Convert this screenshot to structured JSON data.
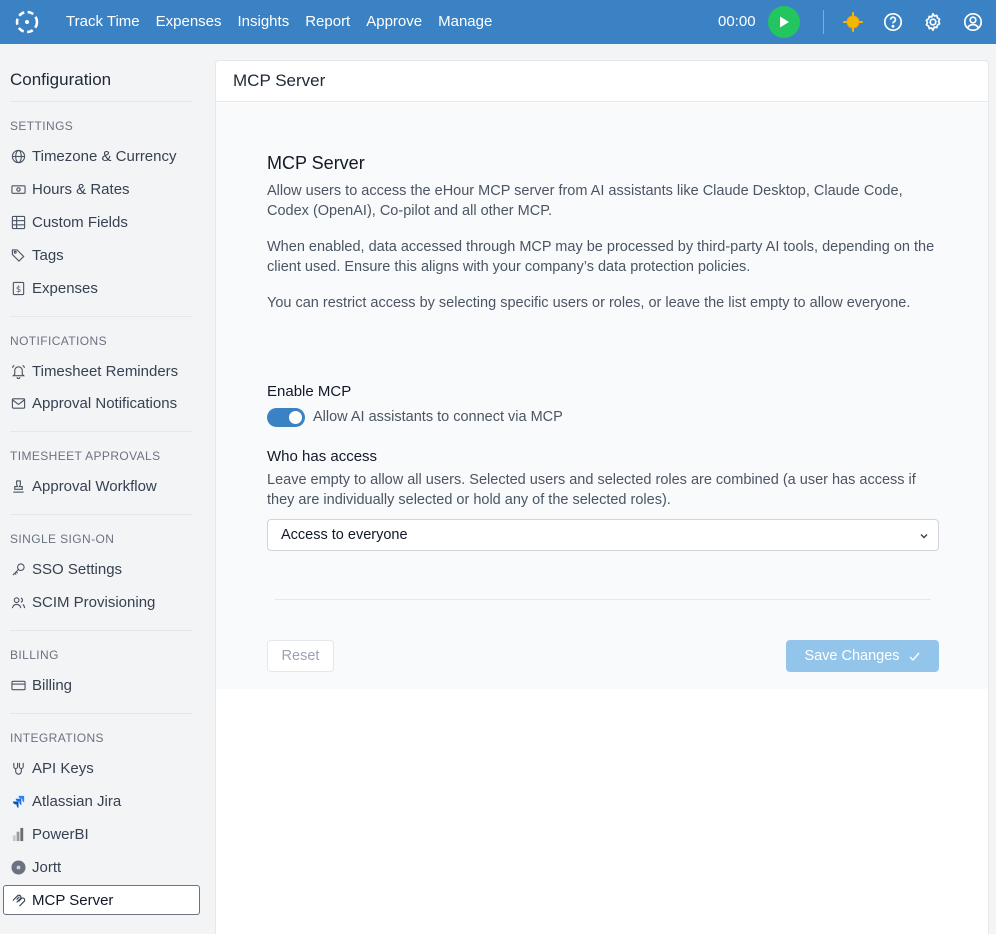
{
  "topbar": {
    "nav": [
      "Track Time",
      "Expenses",
      "Insights",
      "Report",
      "Approve",
      "Manage"
    ],
    "timer": "00:00",
    "accent": "#3b82c4",
    "play_color": "#22c55e"
  },
  "sidebar": {
    "title": "Configuration",
    "sections": {
      "settings": "SETTINGS",
      "notifications": "NOTIFICATIONS",
      "approvals": "TIMESHEET APPROVALS",
      "sso": "SINGLE SIGN-ON",
      "billing": "BILLING",
      "integrations": "INTEGRATIONS"
    },
    "items": {
      "timezone": "Timezone & Currency",
      "hours": "Hours & Rates",
      "custom_fields": "Custom Fields",
      "tags": "Tags",
      "expenses": "Expenses",
      "reminders": "Timesheet Reminders",
      "approval_notifications": "Approval Notifications",
      "approval_workflow": "Approval Workflow",
      "sso_settings": "SSO Settings",
      "scim": "SCIM Provisioning",
      "billing": "Billing",
      "api_keys": "API Keys",
      "jira": "Atlassian Jira",
      "powerbi": "PowerBI",
      "jortt": "Jortt",
      "mcp": "MCP Server"
    }
  },
  "panel": {
    "title": "MCP Server",
    "heading": "MCP Server",
    "desc1": "Allow users to access the eHour MCP server from AI assistants like Claude Desktop, Claude Code, Codex (OpenAI), Co-pilot and all other MCP.",
    "desc2": "When enabled, data accessed through MCP may be processed by third-party AI tools, depending on the client used. Ensure this aligns with your company’s data protection policies.",
    "desc3": "You can restrict access by selecting specific users or roles, or leave the list empty to allow everyone.",
    "enable_label": "Enable MCP",
    "toggle_label": "Allow AI assistants to connect via MCP",
    "toggle_on": true,
    "access_label": "Who has access",
    "access_help": "Leave empty to allow all users. Selected users and selected roles are combined (a user has access if they are individually selected or hold any of the selected roles).",
    "access_value": "Access to everyone",
    "reset_label": "Reset",
    "save_label": "Save Changes"
  }
}
